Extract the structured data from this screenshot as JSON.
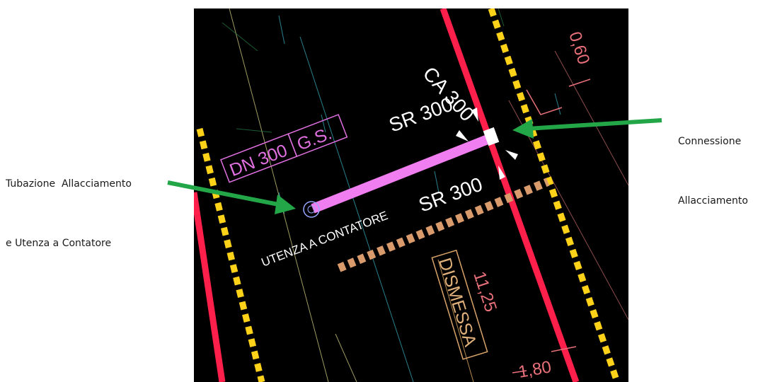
{
  "callouts": {
    "left_line1": "Tubazione  Allacciamento",
    "left_line2": "e Utenza a Contatore",
    "right_line1": "Connessione",
    "right_line2": "Allacciamento"
  },
  "drawing": {
    "pipe_label_dn": "DN 300",
    "pipe_label_gs": "G.S.",
    "ca_label": "CA 300",
    "sr_upper_label": "SR 300",
    "sr_lower_label": "SR 300",
    "utenza_label": "UTENZA A CONTATORE",
    "dismessa_label": "DISMESSA",
    "dim_top": "0,60",
    "dim_mid": "11,25",
    "dim_bottom": "1,80"
  },
  "colors": {
    "background": "#000000",
    "red_line": "#ff1f4b",
    "yellow_dash": "#ffd21a",
    "tan_dash": "#d99a6c",
    "pipe": "#f07ef0",
    "arrow_green": "#23a647",
    "label_magenta": "#e070e0",
    "dim_salmon": "#e8707a"
  }
}
